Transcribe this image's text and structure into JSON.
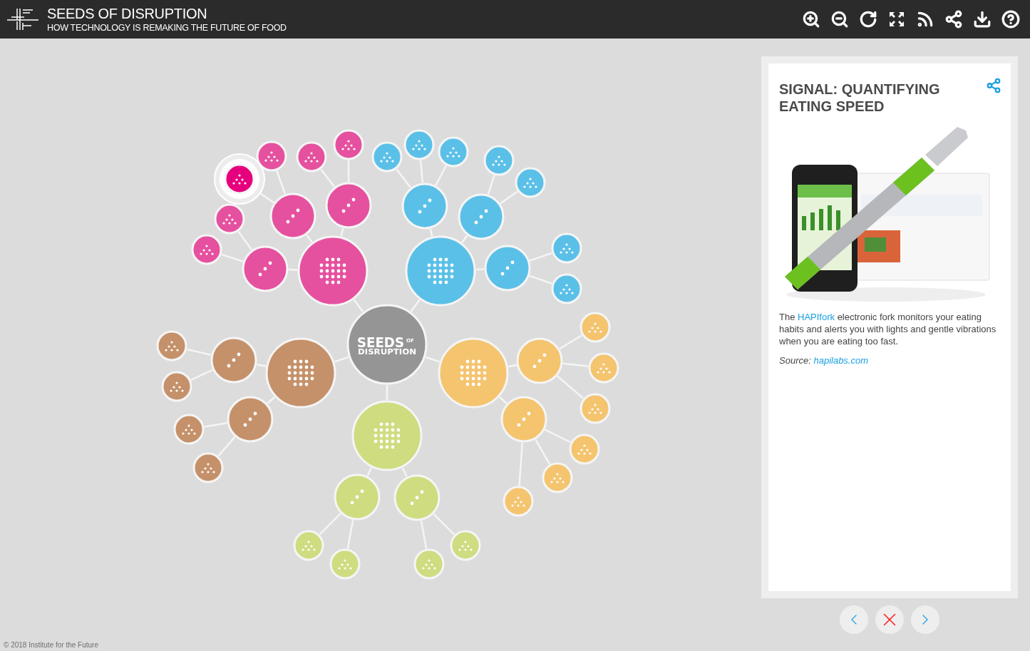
{
  "header": {
    "title": "SEEDS OF DISRUPTION",
    "subtitle": "HOW TECHNOLOGY IS REMAKING THE FUTURE OF FOOD"
  },
  "diagram": {
    "center": {
      "word_1": "SEEDS",
      "word_small": "OF",
      "word_2": "DISRUPTION"
    },
    "clusters": [
      {
        "color": "#e5519f",
        "nodes": [
          {
            "selected": false
          },
          {
            "selected": false
          },
          {
            "selected": false
          },
          {
            "selected": false
          },
          {
            "selected": false
          },
          {
            "selected": false
          },
          {
            "selected": false
          },
          {
            "selected": true
          },
          {
            "selected": false
          },
          {
            "selected": false
          }
        ]
      },
      {
        "color": "#5bc0e8",
        "nodes": [
          {
            "selected": false
          },
          {
            "selected": false
          },
          {
            "selected": false
          },
          {
            "selected": false
          },
          {
            "selected": false
          },
          {
            "selected": false
          },
          {
            "selected": false
          },
          {
            "selected": false
          },
          {
            "selected": false
          },
          {
            "selected": false
          },
          {
            "selected": false
          }
        ]
      },
      {
        "color": "#c5916a",
        "nodes": [
          {
            "selected": false
          },
          {
            "selected": false
          },
          {
            "selected": false
          },
          {
            "selected": false
          },
          {
            "selected": false
          },
          {
            "selected": false
          },
          {
            "selected": false
          }
        ]
      },
      {
        "color": "#f4c46f",
        "nodes": [
          {
            "selected": false
          },
          {
            "selected": false
          },
          {
            "selected": false
          },
          {
            "selected": false
          },
          {
            "selected": false
          },
          {
            "selected": false
          },
          {
            "selected": false
          },
          {
            "selected": false
          },
          {
            "selected": false
          }
        ]
      },
      {
        "color": "#cfdc80",
        "nodes": [
          {
            "selected": false
          },
          {
            "selected": false
          },
          {
            "selected": false
          },
          {
            "selected": false
          },
          {
            "selected": false
          },
          {
            "selected": false
          },
          {
            "selected": false
          }
        ]
      }
    ]
  },
  "panel": {
    "title": "SIGNAL: QUANTIFYING EATING SPEED",
    "body": {
      "before": "The ",
      "link": "HAPIfork",
      "after": " electronic fork monitors your eating habits and alerts you with lights and gentle vibrations when you are eating too fast."
    },
    "source": {
      "label": "Source:",
      "link": "hapilabs.com"
    }
  },
  "footer": {
    "copyright": "© 2018 Institute for the Future"
  }
}
